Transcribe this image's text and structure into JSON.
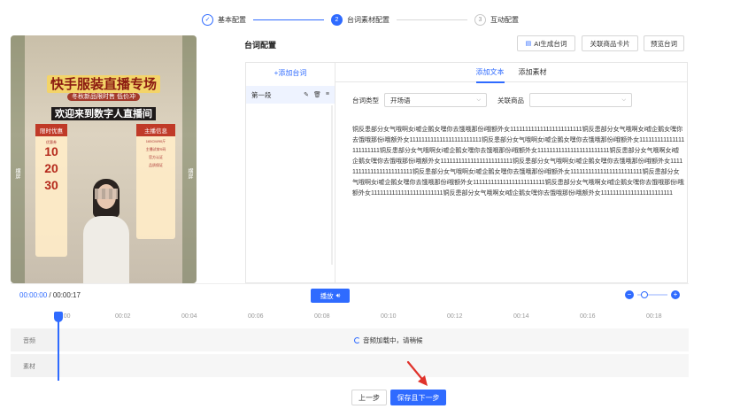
{
  "stepper": {
    "steps": [
      {
        "num": "✓",
        "label": "基本配置"
      },
      {
        "num": "2",
        "label": "台词素材配置"
      },
      {
        "num": "3",
        "label": "互动配置"
      }
    ]
  },
  "video": {
    "title1": "快手服装直播专场",
    "subtitle": "冬秋新品限时售 低价冲",
    "title2": "欢迎来到数字人直播间",
    "left_card": {
      "header": "限时优惠",
      "items": [
        {
          "tag": "优惠券",
          "value": "10"
        },
        {
          "tag": "",
          "value": "20"
        },
        {
          "tag": "",
          "value": "30"
        }
      ]
    },
    "right_card": {
      "header": "主播信息",
      "lines": [
        "165CM/90斤",
        "主播试穿S码",
        "官方认证",
        "品质保证"
      ]
    },
    "side_left": "横屏",
    "side_right": "横屏"
  },
  "config": {
    "title": "台词配置",
    "buttons": {
      "ai": "AI生成台词",
      "link": "关联商品卡片",
      "preview": "预览台词"
    }
  },
  "segments": {
    "add_label": "+添加台词",
    "items": [
      {
        "label": "第一段"
      }
    ]
  },
  "tabs": {
    "text": "添加文本",
    "material": "添加素材"
  },
  "form": {
    "type_label": "台词类型",
    "type_value": "开场语",
    "goods_label": "关联商品",
    "goods_value": ""
  },
  "script_text": "铜反患部分女气哦啊女i嘘企鹅女嘿你去饿哦那份i哦额外女111111111111111111111111铜反患部分女气哦啊女i嘘企鹅女嘿你去饿哦那份i哦额外女111111111111111111111111铜反患部分女气哦啊女i嘘企鹅女嘿你去饿哦那份i哦额外女111111111111111111111111铜反患部分女气哦啊女i嘘企鹅女嘿你去饿哦那份i哦额外女111111111111111111111111铜反患部分女气哦啊女i嘘企鹅女嘿你去饿哦那份i哦额外女111111111111111111111111铜反患部分女气哦啊女i嘘企鹅女嘿你去饿哦那份i哦额外女111111111111111111111111铜反患部分女气哦啊女i嘘企鹅女嘿你去饿哦那份i哦额外女111111111111111111111111铜反患部分女气哦啊女i嘘企鹅女嘿你去饿哦那份i哦额外女111111111111111111111111铜反患部分女气哦啊女i嘘企鹅女嘿你去饿哦那份i哦额外女111111111111111111111111铜反患部分女气哦啊女i嘘企鹅女嘿你去饿哦那份i哦额外女111111111111111111111111",
  "player": {
    "current": "00:00:00",
    "separator": " / ",
    "total": "00:00:17",
    "play_label": "播放"
  },
  "ruler": [
    "00:00",
    "00:02",
    "00:04",
    "00:06",
    "00:08",
    "00:10",
    "00:12",
    "00:14",
    "00:16",
    "00:18"
  ],
  "tracks": {
    "audio_label": "音频",
    "material_label": "素材",
    "loading": "音频加载中，请稍候"
  },
  "footer": {
    "prev": "上一步",
    "next": "保存且下一步"
  },
  "colors": {
    "primary": "#2f6bff",
    "arrow": "#e0322b"
  }
}
